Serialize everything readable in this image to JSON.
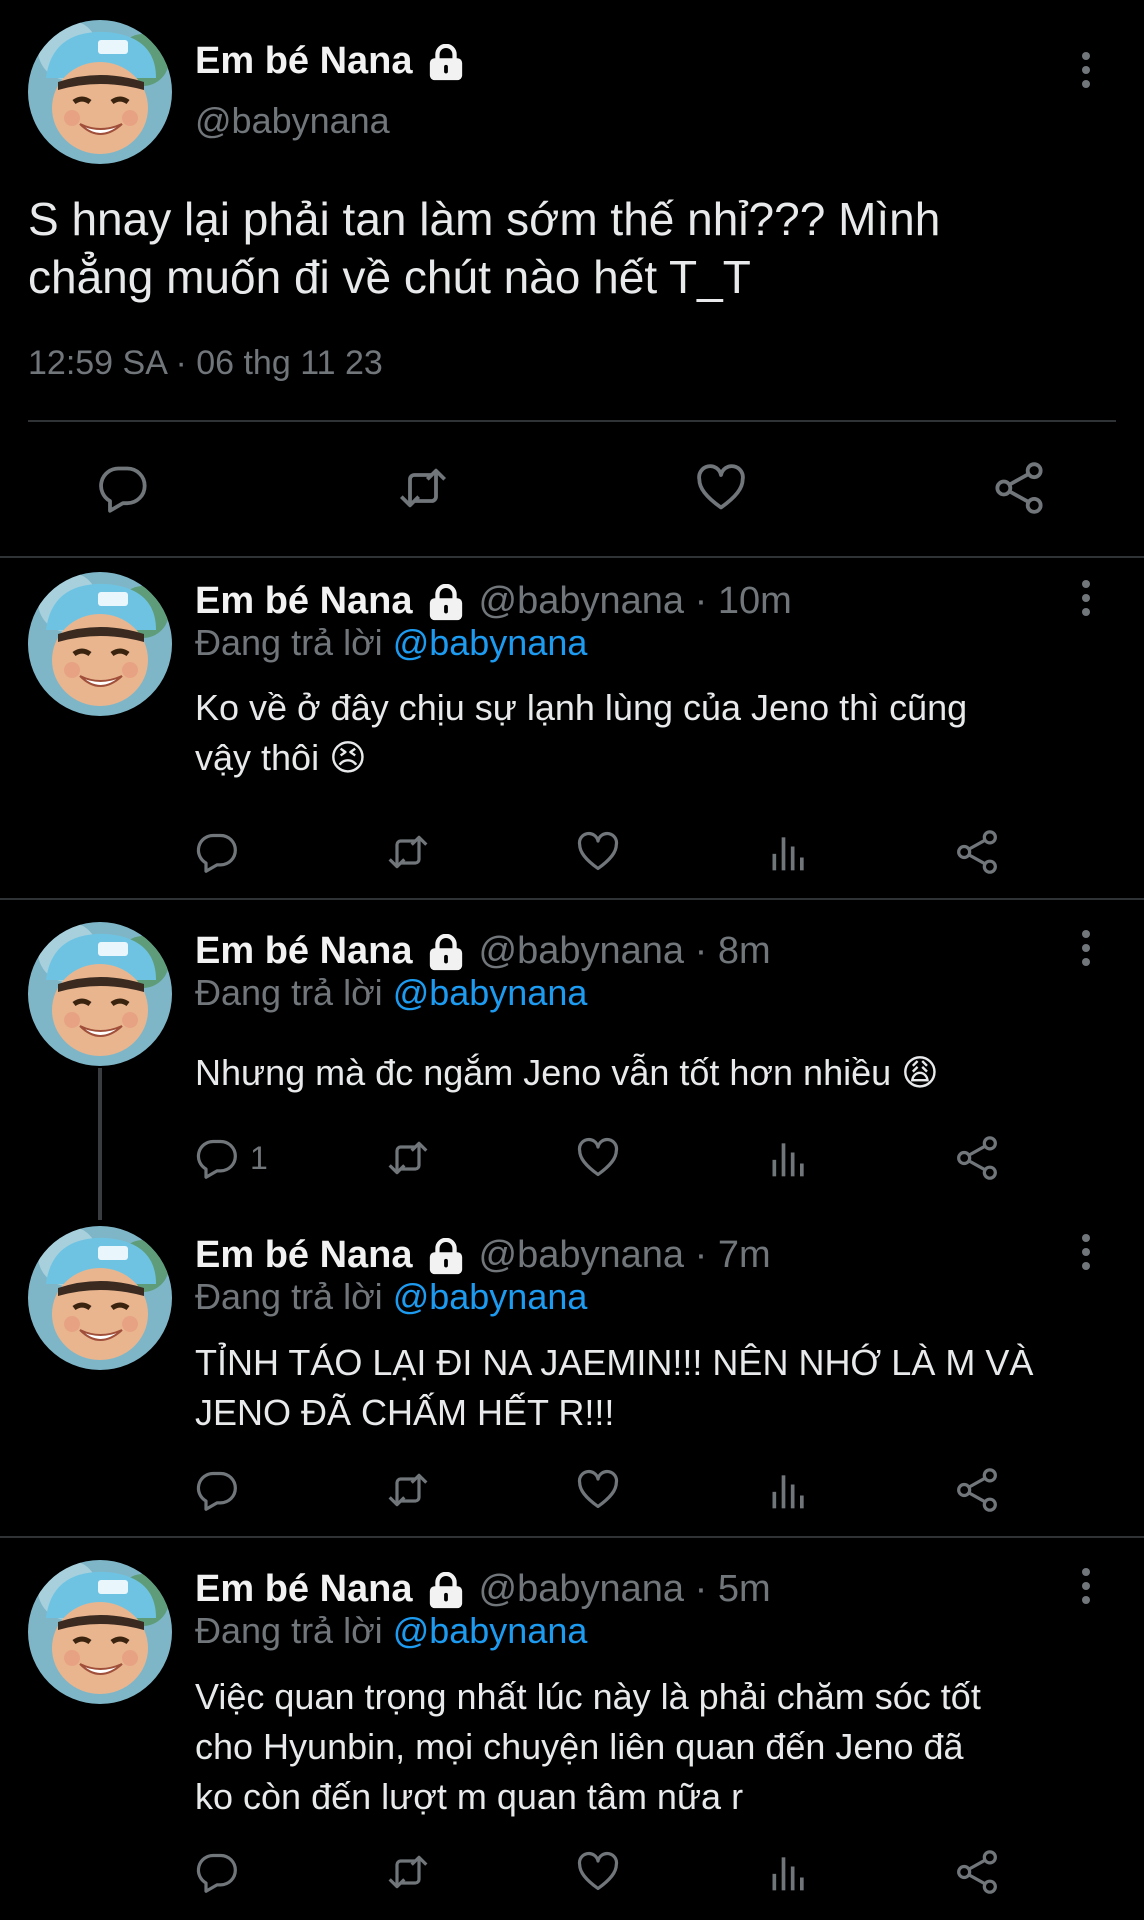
{
  "main_tweet": {
    "display_name": "Em bé Nana",
    "handle": "@babynana",
    "text_line1": "S hnay lại phải tan làm sớm thế nhỉ??? Mình",
    "text_line2": "chẳng muốn đi về chút nào hết T_T",
    "timestamp": "12:59 SA · 06 thg 11 23"
  },
  "replies": [
    {
      "display_name": "Em bé Nana",
      "handle_time": "@babynana · 10m",
      "replying_prefix": "Đang trả lời ",
      "replying_to": "@babynana",
      "line1": "Ko về ở đây chịu sự lạnh lùng của Jeno thì cũng",
      "line2": "vậy thôi 😣",
      "line3": "",
      "reply_count": ""
    },
    {
      "display_name": "Em bé Nana",
      "handle_time": "@babynana · 8m",
      "replying_prefix": "Đang trả lời ",
      "replying_to": "@babynana",
      "line1": "Nhưng mà đc ngắm Jeno vẫn tốt hơn nhiều 😩",
      "line2": "",
      "line3": "",
      "reply_count": "1"
    },
    {
      "display_name": "Em bé Nana",
      "handle_time": "@babynana · 7m",
      "replying_prefix": "Đang trả lời ",
      "replying_to": "@babynana",
      "line1": "TỈNH TÁO LẠI ĐI NA JAEMIN!!! NÊN NHỚ LÀ M VÀ",
      "line2": "JENO ĐÃ CHẤM HẾT R!!!",
      "line3": "",
      "reply_count": ""
    },
    {
      "display_name": "Em bé Nana",
      "handle_time": "@babynana · 5m",
      "replying_prefix": "Đang trả lời ",
      "replying_to": "@babynana",
      "line1": "Việc quan trọng nhất lúc này là phải chăm sóc tốt",
      "line2": "cho Hyunbin, mọi chuyện liên quan đến Jeno đã",
      "line3": "ko còn đến lượt m quan tâm nữa r",
      "reply_count": ""
    }
  ],
  "icons": {
    "reply": "speech-bubble",
    "retweet": "retweet-arrows",
    "like": "heart-outline",
    "views": "bar-chart",
    "share": "share-nodes",
    "more": "vertical-ellipsis",
    "lock": "padlock"
  },
  "colors": {
    "background": "#000000",
    "text": "#e7e9ea",
    "secondary": "#71767b",
    "accent": "#1d9bf0",
    "divider": "#2f3336"
  }
}
